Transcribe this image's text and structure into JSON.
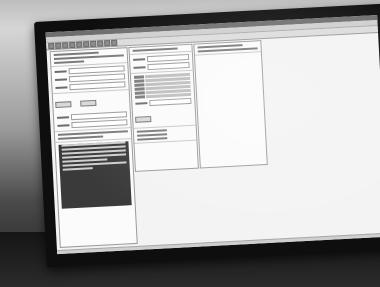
{
  "photo": {
    "brand_text": "",
    "screen_ui": {
      "left_pane_sections": 6,
      "mid_pane_sections": 5
    },
    "colors": {
      "monitor": "#0e0e0e",
      "screen_bg": "#f3f3f3",
      "desk": "#1f1f1f"
    }
  }
}
